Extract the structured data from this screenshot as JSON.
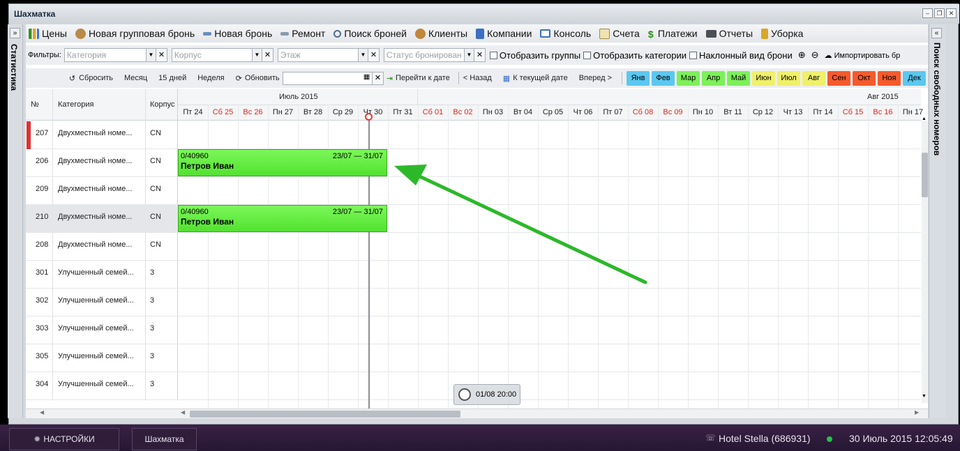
{
  "window": {
    "title": "Шахматка"
  },
  "toolbar": {
    "prices": "Цены",
    "group_booking": "Новая групповая бронь",
    "new_booking": "Новая бронь",
    "repair": "Ремонт",
    "search_bookings": "Поиск броней",
    "clients": "Клиенты",
    "companies": "Компании",
    "console": "Консоль",
    "invoices": "Счета",
    "payments": "Платежи",
    "reports": "Отчеты",
    "cleaning": "Уборка"
  },
  "filters": {
    "label": "Фильтры:",
    "category_placeholder": "Категория",
    "building_placeholder": "Корпус",
    "floor_placeholder": "Этаж",
    "status_placeholder": "Статус бронирован",
    "show_groups": "Отобразить группы",
    "show_categories": "Отобразить категории",
    "tilted_view": "Наклонный вид брони",
    "import": "Импортировать бр"
  },
  "nav": {
    "reset": "Сбросить",
    "month": "Месяц",
    "days15": "15 дней",
    "week": "Неделя",
    "refresh": "Обновить",
    "goto_date": "Перейти к дате",
    "back": "< Назад",
    "to_current": "К текущей дате",
    "forward": "Вперед >",
    "months": [
      "Янв",
      "Фев",
      "Мар",
      "Апр",
      "Май",
      "Июн",
      "Июл",
      "Авг",
      "Сен",
      "Окт",
      "Ноя",
      "Дек"
    ],
    "month_colors": [
      "#5bc8f0",
      "#5bc8f0",
      "#7df05a",
      "#7df05a",
      "#7df05a",
      "#f0f06a",
      "#f0f06a",
      "#f0f06a",
      "#f55a2c",
      "#f55a2c",
      "#f55a2c",
      "#5bc8f0"
    ]
  },
  "grid": {
    "col_no": "№",
    "col_category": "Категория",
    "col_building": "Корпус",
    "month_jul": "Июль 2015",
    "month_aug": "Авг 2015",
    "days": [
      {
        "label": "Пт 24",
        "weekend": false
      },
      {
        "label": "Сб 25",
        "weekend": true
      },
      {
        "label": "Вс 26",
        "weekend": true
      },
      {
        "label": "Пн 27",
        "weekend": false
      },
      {
        "label": "Вт 28",
        "weekend": false
      },
      {
        "label": "Ср 29",
        "weekend": false
      },
      {
        "label": "Чт 30",
        "weekend": false
      },
      {
        "label": "Пт 31",
        "weekend": false
      },
      {
        "label": "Сб 01",
        "weekend": true
      },
      {
        "label": "Вс 02",
        "weekend": true
      },
      {
        "label": "Пн 03",
        "weekend": false
      },
      {
        "label": "Вт 04",
        "weekend": false
      },
      {
        "label": "Ср 05",
        "weekend": false
      },
      {
        "label": "Чт 06",
        "weekend": false
      },
      {
        "label": "Пт 07",
        "weekend": false
      },
      {
        "label": "Сб 08",
        "weekend": true
      },
      {
        "label": "Вс 09",
        "weekend": true
      },
      {
        "label": "Пн 10",
        "weekend": false
      },
      {
        "label": "Вт 11",
        "weekend": false
      },
      {
        "label": "Ср 12",
        "weekend": false
      },
      {
        "label": "Чт 13",
        "weekend": false
      },
      {
        "label": "Пт 14",
        "weekend": false
      },
      {
        "label": "Сб 15",
        "weekend": true
      },
      {
        "label": "Вс 16",
        "weekend": true
      },
      {
        "label": "Пн 17",
        "weekend": false
      }
    ],
    "rooms": [
      {
        "no": "207",
        "category": "Двухместный номе...",
        "building": "CN",
        "flag": true
      },
      {
        "no": "206",
        "category": "Двухместный номе...",
        "building": "CN",
        "flag": false
      },
      {
        "no": "209",
        "category": "Двухместный номе...",
        "building": "CN",
        "flag": false
      },
      {
        "no": "210",
        "category": "Двухместный номе...",
        "building": "CN",
        "flag": false
      },
      {
        "no": "208",
        "category": "Двухместный номе...",
        "building": "CN",
        "flag": false
      },
      {
        "no": "301",
        "category": "Улучшенный семей...",
        "building": "3",
        "flag": false
      },
      {
        "no": "302",
        "category": "Улучшенный семей...",
        "building": "3",
        "flag": false
      },
      {
        "no": "303",
        "category": "Улучшенный семей...",
        "building": "3",
        "flag": false
      },
      {
        "no": "305",
        "category": "Улучшенный семей...",
        "building": "3",
        "flag": false
      },
      {
        "no": "304",
        "category": "Улучшенный семей...",
        "building": "3",
        "flag": false
      }
    ],
    "bookings": [
      {
        "room": "206",
        "id": "0/40960",
        "dates": "23/07 — 31/07",
        "guest": "Петров Иван"
      },
      {
        "room": "210",
        "id": "0/40960",
        "dates": "23/07 — 31/07",
        "guest": "Петров Иван"
      }
    ],
    "tooltip_time": "01/08 20:00"
  },
  "side": {
    "left": "Статистика",
    "right": "Поиск свободных номеров"
  },
  "taskbar": {
    "settings": "НАСТРОЙКИ",
    "chess": "Шахматка",
    "hotel": "Hotel Stella (686931)",
    "datetime": "30 Июль 2015 12:05:49"
  }
}
